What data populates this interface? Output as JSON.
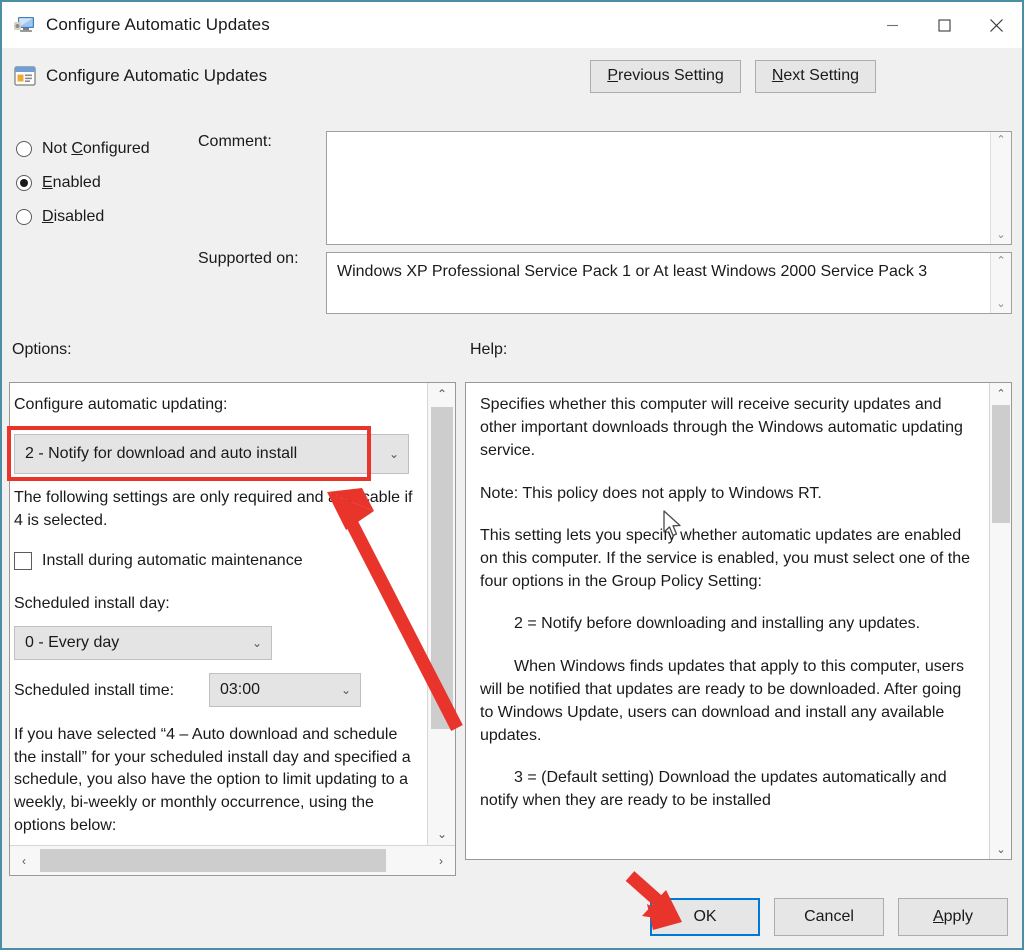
{
  "window": {
    "title": "Configure Automatic Updates",
    "icon": "monitor-settings-icon",
    "controls": {
      "minimize": "minimize-icon",
      "maximize": "maximize-icon",
      "close": "close-icon"
    },
    "border_color": "#4a8fa5"
  },
  "header": {
    "icon": "policy-setting-icon",
    "title": "Configure Automatic Updates",
    "previous_setting": "Previous Setting",
    "previous_setting_accel": "P",
    "next_setting": "Next Setting",
    "next_setting_accel": "N"
  },
  "state": {
    "options": [
      {
        "label": "Not Configured",
        "accel": "C",
        "selected": false
      },
      {
        "label": "Enabled",
        "accel": "E",
        "selected": true
      },
      {
        "label": "Disabled",
        "accel": "D",
        "selected": false
      }
    ]
  },
  "fields": {
    "comment_label": "Comment:",
    "comment_value": "",
    "comment_placeholder": "",
    "supported_label": "Supported on:",
    "supported_value": "Windows XP Professional Service Pack 1 or At least Windows 2000 Service Pack 3"
  },
  "panels": {
    "options_label": "Options:",
    "help_label": "Help:"
  },
  "options": {
    "updating_label": "Configure automatic updating:",
    "updating_value": "2 - Notify for download and auto install",
    "note": "The following settings are only required and applicable if 4 is selected.",
    "maintenance_checkbox_label": "Install during automatic maintenance",
    "maintenance_checked": false,
    "day_label": "Scheduled install day:",
    "day_value": "0 - Every day",
    "time_label": "Scheduled install time:",
    "time_value": "03:00",
    "footer_text": "If you have selected “4 – Auto download and schedule the install” for your scheduled install day and specified a schedule, you also have the option to limit updating to a weekly, bi-weekly or monthly occurrence, using the options below:"
  },
  "help": {
    "paragraphs": [
      {
        "text": "Specifies whether this computer will receive security updates and other important downloads through the Windows automatic updating service.",
        "indent": false
      },
      {
        "text": "Note: This policy does not apply to Windows RT.",
        "indent": false
      },
      {
        "text": "This setting lets you specify whether automatic updates are enabled on this computer. If the service is enabled, you must select one of the four options in the Group Policy Setting:",
        "indent": false
      },
      {
        "text": "2 = Notify before downloading and installing any updates.",
        "indent": true
      },
      {
        "text": "When Windows finds updates that apply to this computer, users will be notified that updates are ready to be downloaded. After going to Windows Update, users can download and install any available updates.",
        "indent": true
      },
      {
        "text": "3 = (Default setting) Download the updates automatically and notify when they are ready to be installed",
        "indent": true
      }
    ]
  },
  "footer": {
    "ok": "OK",
    "cancel": "Cancel",
    "apply": "Apply",
    "apply_accel": "A",
    "ok_focused": true
  },
  "annotations": {
    "highlight_color": "#e8342a",
    "rect_target": "configure-automatic-updating-dropdown",
    "arrow_1_target": "configure-automatic-updating-dropdown",
    "arrow_2_target": "ok-button"
  },
  "icons": {
    "scroll_up": "⌃",
    "scroll_down": "⌄",
    "scroll_left": "‹",
    "scroll_right": "›",
    "caret_down": "⌄"
  }
}
